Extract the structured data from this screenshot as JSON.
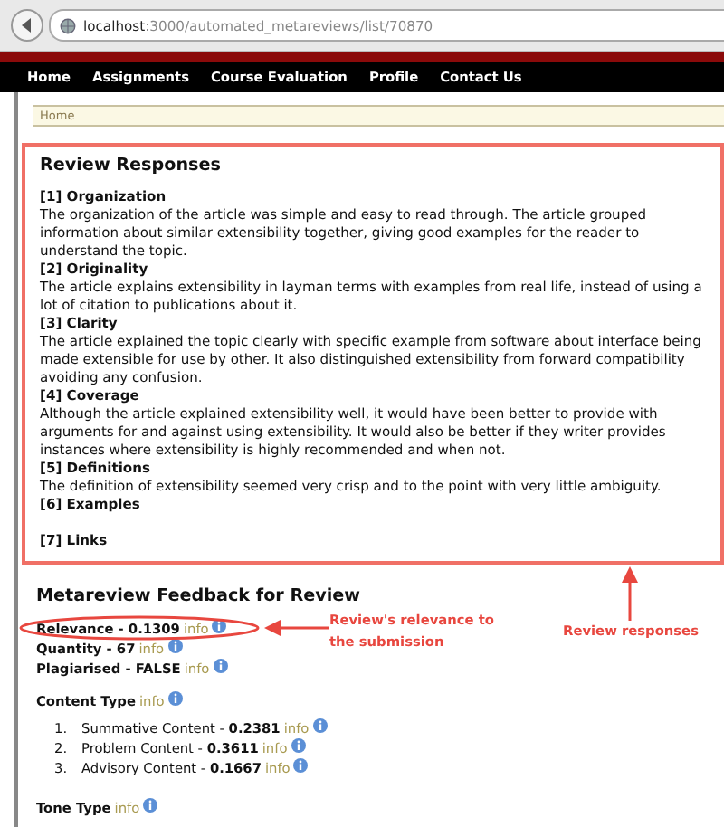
{
  "browser": {
    "url_host": "localhost",
    "url_path": ":3000/automated_metareviews/list/70870"
  },
  "nav": {
    "items": [
      "Home",
      "Assignments",
      "Course Evaluation",
      "Profile",
      "Contact Us"
    ]
  },
  "breadcrumb": "Home",
  "review": {
    "title": "Review Responses",
    "questions": [
      {
        "heading": "[1] Organization",
        "answer": "The organization of the article was simple and easy to read through. The article grouped information about similar extensibility together, giving good examples for the reader to understand the topic."
      },
      {
        "heading": "[2] Originality",
        "answer": "The article explains extensibility in layman terms with examples from real life, instead of using a lot of citation to publications about it."
      },
      {
        "heading": "[3] Clarity",
        "answer": "The article explained the topic clearly with specific example from software about interface being made extensible for use by other. It also distinguished extensibility from forward compatibility avoiding any confusion."
      },
      {
        "heading": "[4] Coverage",
        "answer": "Although the article explained extensibility well, it would have been better to provide with arguments for and against using extensibility. It would also be better if they writer provides instances where extensibility is highly recommended and when not."
      },
      {
        "heading": "[5] Definitions",
        "answer": "The definition of extensibility seemed very crisp and to the point with very little ambiguity."
      },
      {
        "heading": "[6] Examples"
      },
      {
        "heading": "[7] Links"
      }
    ]
  },
  "feedback": {
    "title": "Metareview Feedback for Review",
    "metrics": [
      {
        "label": "Relevance - 0.1309",
        "info": "info"
      },
      {
        "label": "Quantity - 67",
        "info": "info"
      },
      {
        "label": "Plagiarised - FALSE",
        "info": "info"
      }
    ],
    "content_type": {
      "title": "Content Type",
      "info": "info",
      "items": [
        {
          "number": "1.",
          "label": "Summative Content - ",
          "value": "0.2381",
          "info": "info"
        },
        {
          "number": "2.",
          "label": "Problem Content - ",
          "value": "0.3611",
          "info": "info"
        },
        {
          "number": "3.",
          "label": "Advisory Content - ",
          "value": "0.1667",
          "info": "info"
        }
      ]
    },
    "tone_type": {
      "title": "Tone Type",
      "info": "info"
    }
  },
  "annotations": [
    {
      "kind": "relevance",
      "text": "Review's relevance to the submission"
    },
    {
      "kind": "responses",
      "text": "Review responses"
    }
  ]
}
